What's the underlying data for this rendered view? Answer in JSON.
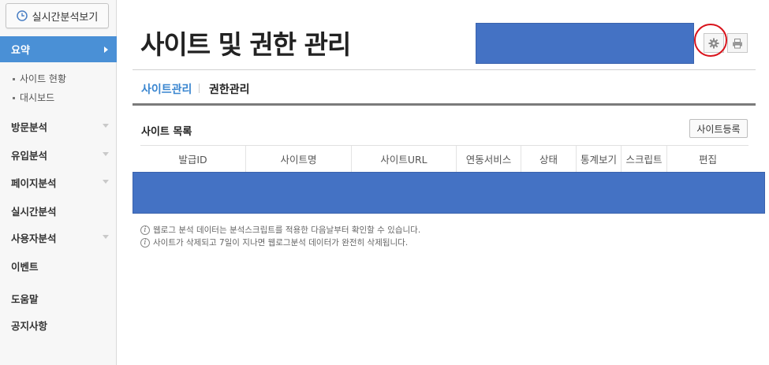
{
  "sidebar": {
    "realtime_button": "실시간분석보기",
    "summary": "요약",
    "sub_items": [
      "사이트 현황",
      "대시보드"
    ],
    "nav": [
      {
        "label": "방문분석",
        "caret": true
      },
      {
        "label": "유입분석",
        "caret": true
      },
      {
        "label": "페이지분석",
        "caret": true
      },
      {
        "label": "실시간분석",
        "caret": false
      },
      {
        "label": "사용자분석",
        "caret": true
      },
      {
        "label": "이벤트",
        "caret": false
      },
      {
        "label": "도움말",
        "caret": false
      },
      {
        "label": "공지사항",
        "caret": false
      }
    ]
  },
  "header": {
    "title": "사이트 및 권한 관리"
  },
  "tabs": {
    "active": "사이트관리",
    "other": "권한관리"
  },
  "section": {
    "title": "사이트 목록",
    "register_button": "사이트등록"
  },
  "table": {
    "columns": [
      "발급ID",
      "사이트명",
      "사이트URL",
      "연동서비스",
      "상태",
      "통계보기",
      "스크립트",
      "편집"
    ]
  },
  "notes": [
    "웹로그 분석 데이터는 분석스크립트를 적용한 다음날부터 확인할 수 있습니다.",
    "사이트가 삭제되고 7일이 지나면 웹로그분석 데이터가 완전히 삭제됩니다."
  ],
  "colors": {
    "accent": "#4a90d6",
    "redaction": "#4472c4",
    "highlight_circle": "#d9141c"
  }
}
